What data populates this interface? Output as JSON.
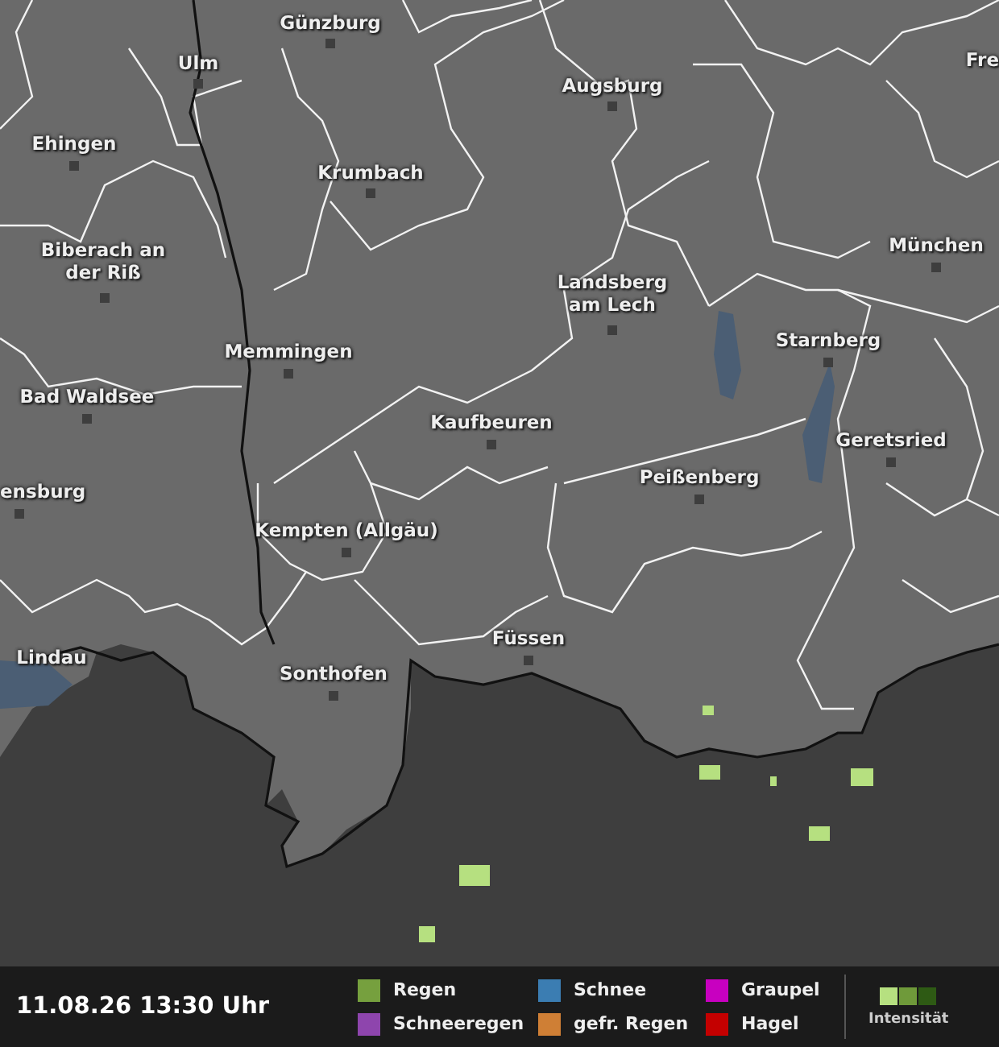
{
  "map": {
    "cities": [
      {
        "name": "Günzburg"
      },
      {
        "name": "Ulm"
      },
      {
        "name": "Ehingen"
      },
      {
        "name": "Krumbach"
      },
      {
        "name": "Biberach an der Riß"
      },
      {
        "name": "Memmingen"
      },
      {
        "name": "Bad Waldsee"
      },
      {
        "name": "Augsburg"
      },
      {
        "name": "Fre"
      },
      {
        "name": "München"
      },
      {
        "name": "Landsberg am Lech"
      },
      {
        "name": "Starnberg"
      },
      {
        "name": "Geretsried"
      },
      {
        "name": "Kaufbeuren"
      },
      {
        "name": "Peißenberg"
      },
      {
        "name": "ensburg"
      },
      {
        "name": "Kempten (Allgäu)"
      },
      {
        "name": "Lindau"
      },
      {
        "name": "Füssen"
      },
      {
        "name": "Sonthofen"
      }
    ]
  },
  "legend": {
    "timestamp": "11.08.26 13:30 Uhr",
    "types": [
      {
        "label": "Regen",
        "color": "#76a03e"
      },
      {
        "label": "Schneeregen",
        "color": "#8e45ad"
      },
      {
        "label": "Schnee",
        "color": "#3b7db2"
      },
      {
        "label": "gefr. Regen",
        "color": "#cf7f35"
      },
      {
        "label": "Graupel",
        "color": "#c800c0"
      },
      {
        "label": "Hagel",
        "color": "#c40000"
      }
    ],
    "intensity_label": "Intensität"
  }
}
